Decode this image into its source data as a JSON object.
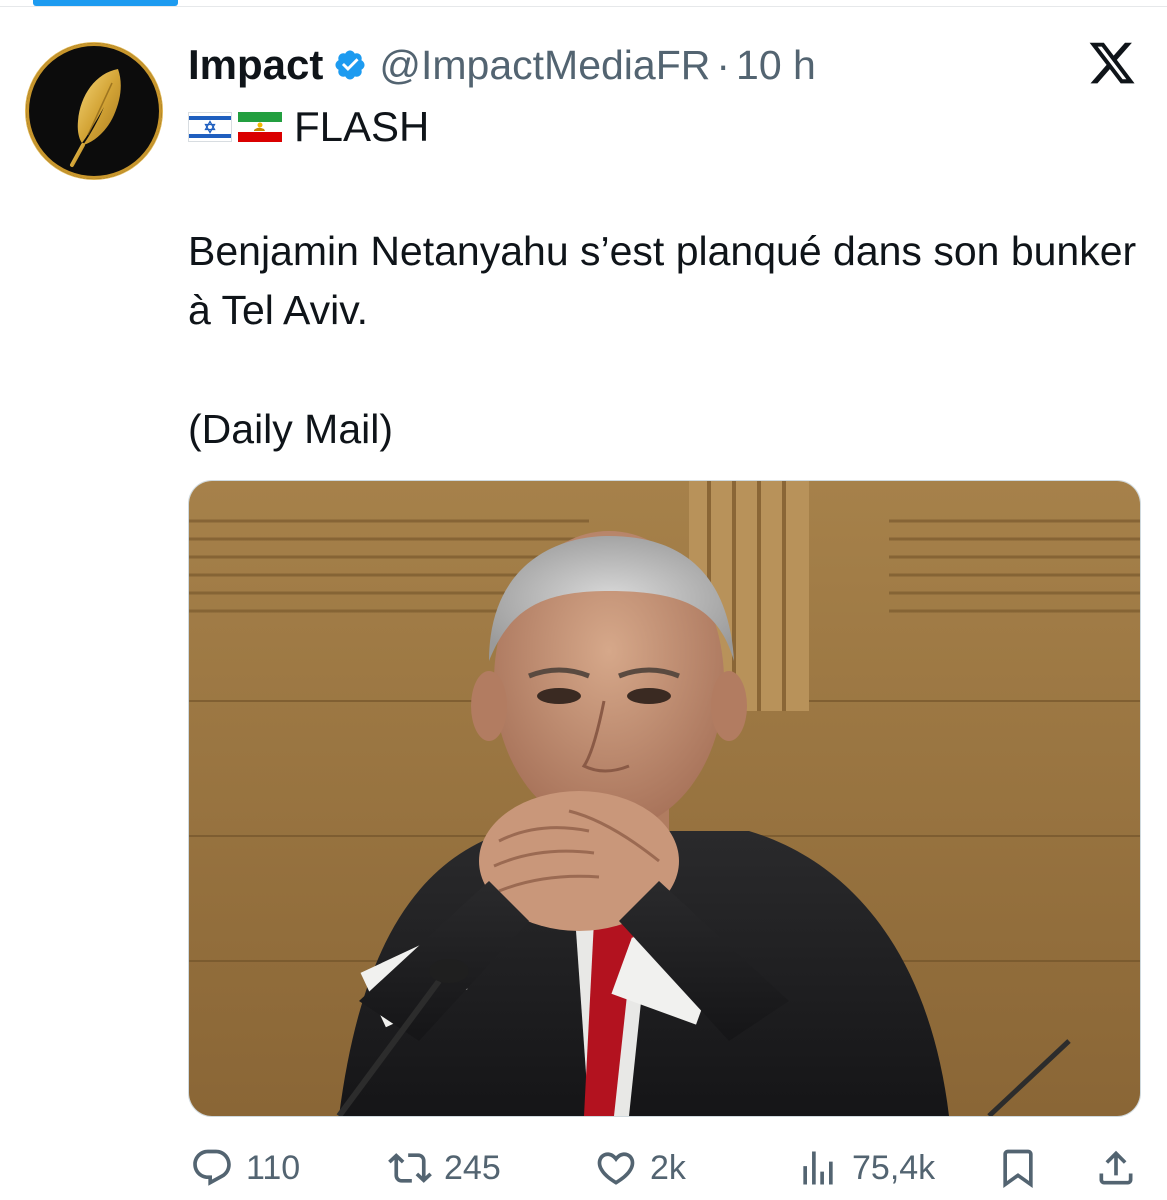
{
  "author": {
    "name": "Impact",
    "handle": "@ImpactMediaFR",
    "separator": "·",
    "time": "10 h"
  },
  "headline": {
    "flags": [
      "israel-flag",
      "iran-lion-sun-flag"
    ],
    "text": "FLASH"
  },
  "body": {
    "line1": "Benjamin Netanyahu s’est planqué dans son bunker à Tel Aviv.",
    "source": "(Daily Mail)"
  },
  "actions": {
    "replies": "110",
    "reposts": "245",
    "likes": "2k",
    "views": "75,4k"
  },
  "colors": {
    "accent": "#1d9bf0",
    "muted": "#536471",
    "text": "#0f1419",
    "avatar_gold": "#d4a537"
  },
  "icons": {
    "close_logo": "x-logo-icon",
    "verified": "verified-badge-icon",
    "reply": "reply-icon",
    "repost": "repost-icon",
    "like": "heart-icon",
    "views": "views-chart-icon",
    "bookmark": "bookmark-icon",
    "share": "share-icon"
  }
}
